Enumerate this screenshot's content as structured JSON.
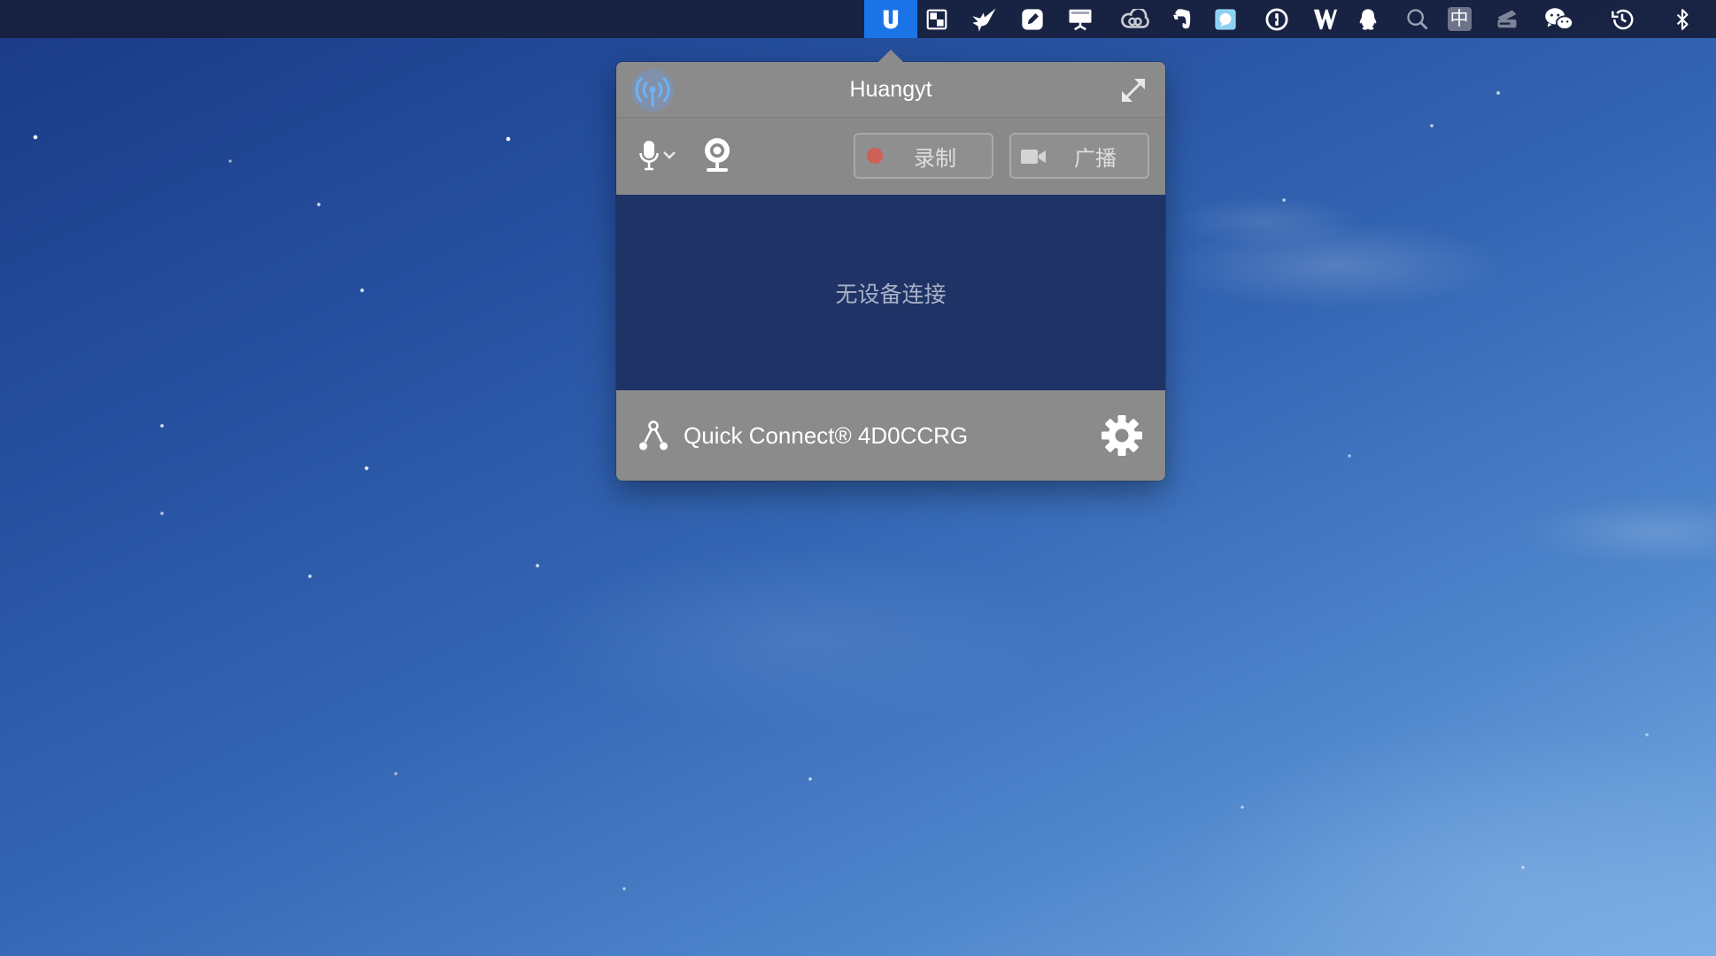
{
  "menubar": {
    "icons": [
      {
        "name": "paste-app",
        "active": true
      },
      {
        "name": "checkerboard"
      },
      {
        "name": "bird"
      },
      {
        "name": "note-pencil"
      },
      {
        "name": "presentation-display"
      },
      {
        "name": "creative-cloud"
      },
      {
        "name": "evernote"
      },
      {
        "name": "bubble-app"
      },
      {
        "name": "1password"
      },
      {
        "name": "double-v"
      },
      {
        "name": "qq"
      },
      {
        "name": "search"
      },
      {
        "name": "input-method",
        "label": "中"
      },
      {
        "name": "scanner"
      },
      {
        "name": "wechat"
      },
      {
        "name": "time-machine"
      },
      {
        "name": "bluetooth"
      }
    ]
  },
  "popover": {
    "title": "Huangyt",
    "record_button": "录制",
    "broadcast_button": "广播",
    "status_message": "无设备连接",
    "quick_connect": "Quick Connect® 4D0CCRG"
  },
  "colors": {
    "menubar_accent": "#1a74e8",
    "popover_gray": "#8b8b8b",
    "panel_navy": "#1f3366",
    "record_dot": "#d9584e"
  }
}
